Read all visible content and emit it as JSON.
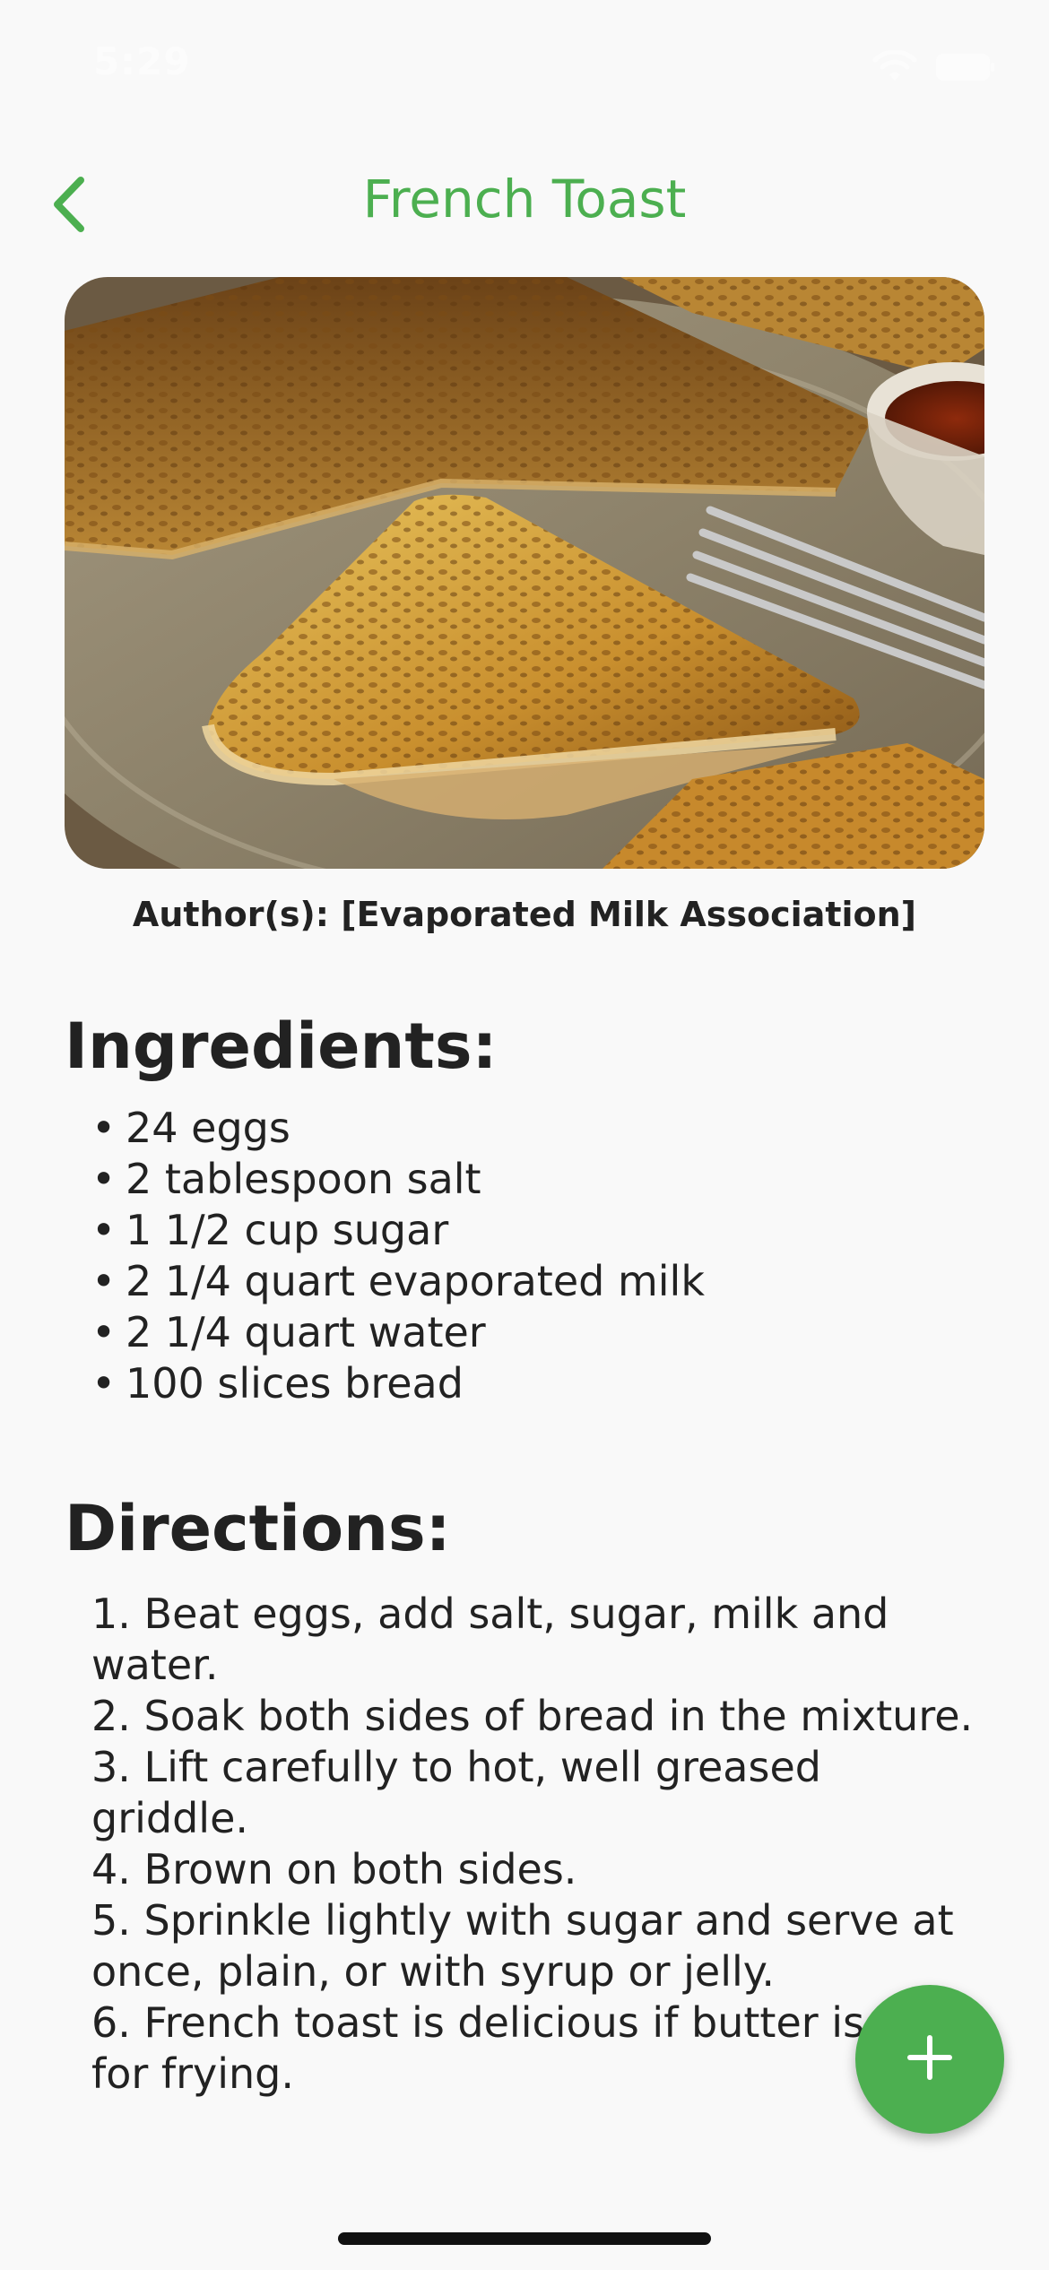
{
  "status_bar": {
    "time": "5:29",
    "icons": [
      "wifi-icon",
      "battery-icon"
    ]
  },
  "header": {
    "title": "French Toast",
    "back_icon": "chevron-left-icon",
    "accent_color": "#4caf50"
  },
  "recipe": {
    "image_subject": "french toast on a plate with syrup and fork",
    "author": "Author(s): [Evaporated Milk Association]",
    "ingredients_title": "Ingredients:",
    "ingredients": [
      "24 eggs",
      "2 tablespoon salt",
      "1 1/2 cup sugar",
      "2 1/4 quart evaporated milk",
      "2 1/4 quart water",
      "100 slices bread"
    ],
    "directions_title": "Directions:",
    "directions": [
      "1. Beat eggs, add salt, sugar, milk and water.",
      "2. Soak both sides of bread in the mixture.",
      "3. Lift carefully to hot, well greased griddle.",
      "4. Brown on both sides.",
      "5. Sprinkle lightly with sugar and serve at once, plain, or with syrup or jelly.",
      "6. French toast is delicious if butter is used for frying."
    ]
  },
  "fab": {
    "icon": "plus-icon",
    "color": "#4caf50"
  }
}
